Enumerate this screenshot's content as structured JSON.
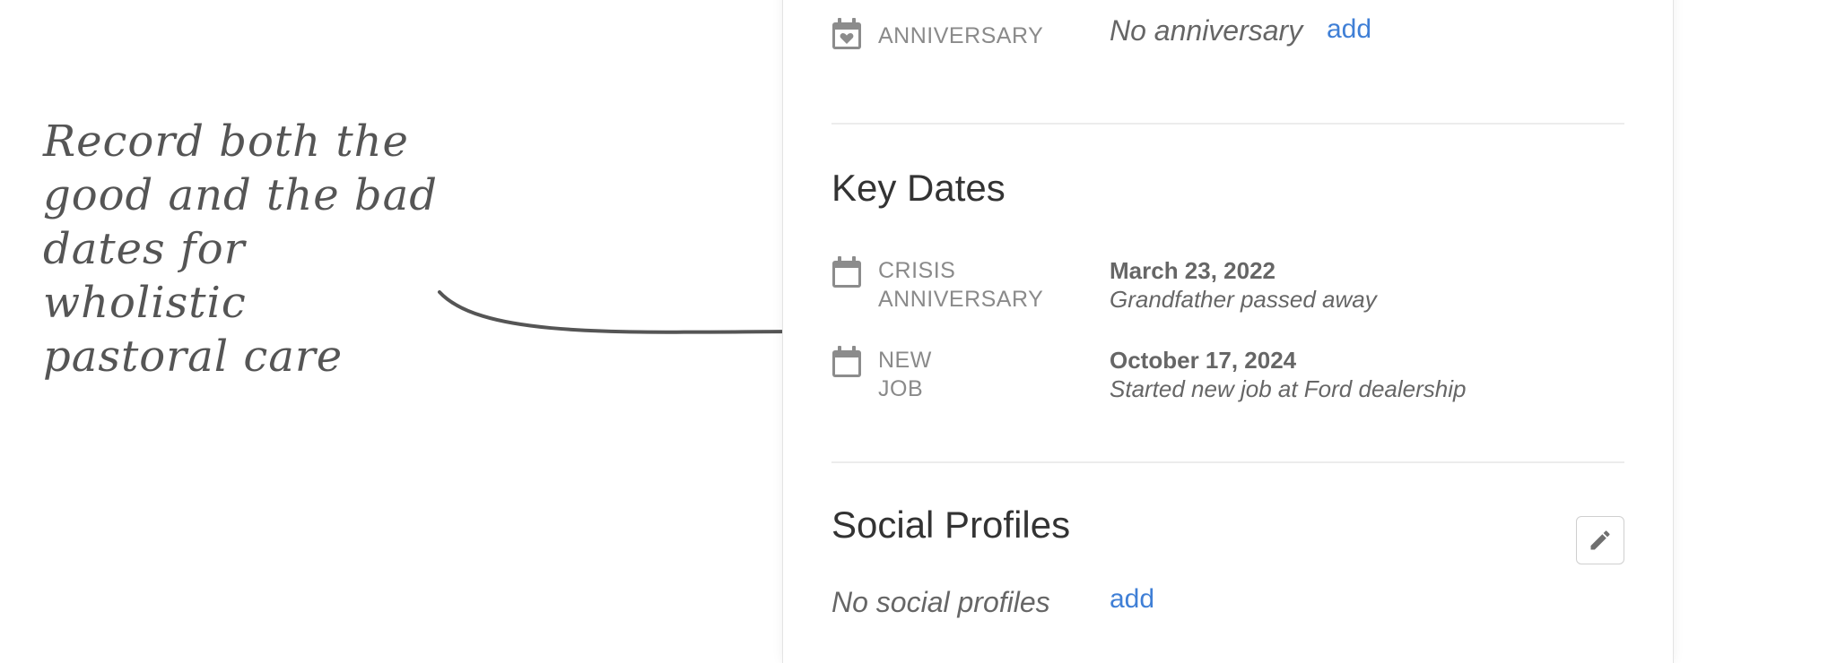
{
  "annotation": {
    "lines": [
      "Record both the",
      "good and the bad",
      "dates for wholistic",
      "pastoral care"
    ]
  },
  "anniversary": {
    "label": "ANNIVERSARY",
    "value": "No anniversary",
    "add_label": "add",
    "icon": "calendar-heart-icon"
  },
  "key_dates": {
    "title": "Key Dates",
    "items": [
      {
        "label_line1": "CRISIS",
        "label_line2": "ANNIVERSARY",
        "date": "March 23, 2022",
        "note": "Grandfather passed away",
        "icon": "calendar-icon"
      },
      {
        "label_line1": "NEW JOB",
        "label_line2": "",
        "date": "October 17, 2024",
        "note": "Started new job at Ford dealership",
        "icon": "calendar-icon"
      }
    ]
  },
  "social_profiles": {
    "title": "Social Profiles",
    "empty_text": "No social profiles",
    "add_label": "add",
    "edit_icon": "pencil-icon"
  },
  "colors": {
    "link": "#3f7fd6",
    "text": "#333333",
    "muted": "#8a8a8a"
  }
}
